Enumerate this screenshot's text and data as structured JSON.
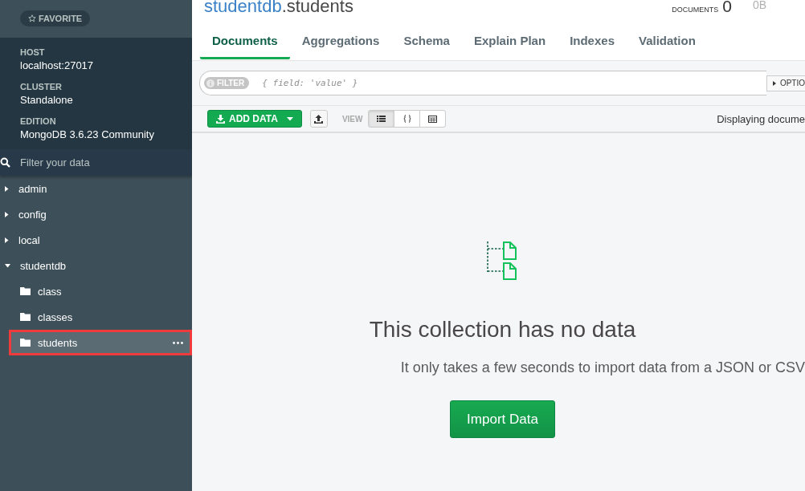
{
  "sidebar": {
    "favorite_button": "FAVORITE",
    "instance_info": [
      {
        "label": "HOST",
        "value": "localhost:27017"
      },
      {
        "label": "CLUSTER",
        "value": "Standalone"
      },
      {
        "label": "EDITION",
        "value": "MongoDB 3.6.23 Community"
      }
    ],
    "filter": {
      "placeholder": "Filter your data"
    },
    "databases": [
      {
        "name": "admin",
        "expanded": false
      },
      {
        "name": "config",
        "expanded": false
      },
      {
        "name": "local",
        "expanded": false
      },
      {
        "name": "studentdb",
        "expanded": true,
        "children": [
          {
            "name": "class",
            "selected": false,
            "highlighted": false
          },
          {
            "name": "classes",
            "selected": false,
            "highlighted": false
          },
          {
            "name": "students",
            "selected": true,
            "highlighted": true
          }
        ]
      }
    ]
  },
  "header": {
    "database": "studentdb",
    "collection": ".students",
    "stats": [
      {
        "label": "DOCUMENTS",
        "value": "0"
      },
      {
        "value": "0B"
      }
    ]
  },
  "tabs": [
    {
      "label": "Documents",
      "selected": true
    },
    {
      "label": "Aggregations",
      "selected": false
    },
    {
      "label": "Schema",
      "selected": false
    },
    {
      "label": "Explain Plan",
      "selected": false
    },
    {
      "label": "Indexes",
      "selected": false
    },
    {
      "label": "Validation",
      "selected": false
    }
  ],
  "query_bar": {
    "filter_badge": "FILTER",
    "placeholder": "{ field: 'value' }",
    "options_button": "OPTIO"
  },
  "toolbar": {
    "add_data_button": "ADD DATA",
    "view_label": "VIEW",
    "views": [
      {
        "kind": "list",
        "selected": true
      },
      {
        "kind": "json",
        "selected": false
      },
      {
        "kind": "table",
        "selected": false
      }
    ],
    "status": "Displaying docume"
  },
  "empty_state": {
    "title": "This collection has no data",
    "message": "It only takes a few seconds to import data from a JSON or CSV",
    "button": "Import Data"
  }
}
